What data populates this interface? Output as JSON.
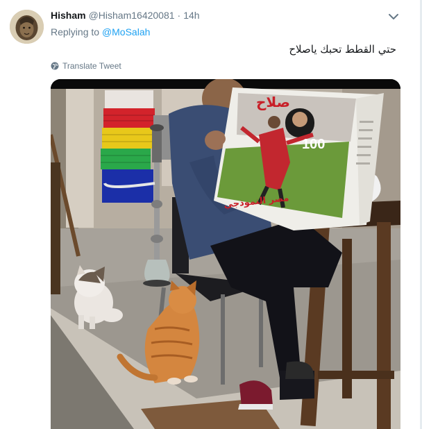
{
  "tweet": {
    "display_name": "Hisham",
    "handle": "@Hisham16420081",
    "separator": "·",
    "time": "14h",
    "replying_prefix": "Replying to",
    "reply_to": "@MoSalah",
    "text": "حتي القطط تحبك ياصلاح",
    "translate_label": "Translate Tweet"
  },
  "newspaper": {
    "headline": "صلاح",
    "number": "100",
    "footer_text": "مصر النموذجي"
  },
  "colors": {
    "link": "#1da1f2",
    "secondary_text": "#657786",
    "border": "#e6ecf0"
  },
  "icons": {
    "caret": "chevron-down-icon",
    "translate": "globe-icon"
  }
}
